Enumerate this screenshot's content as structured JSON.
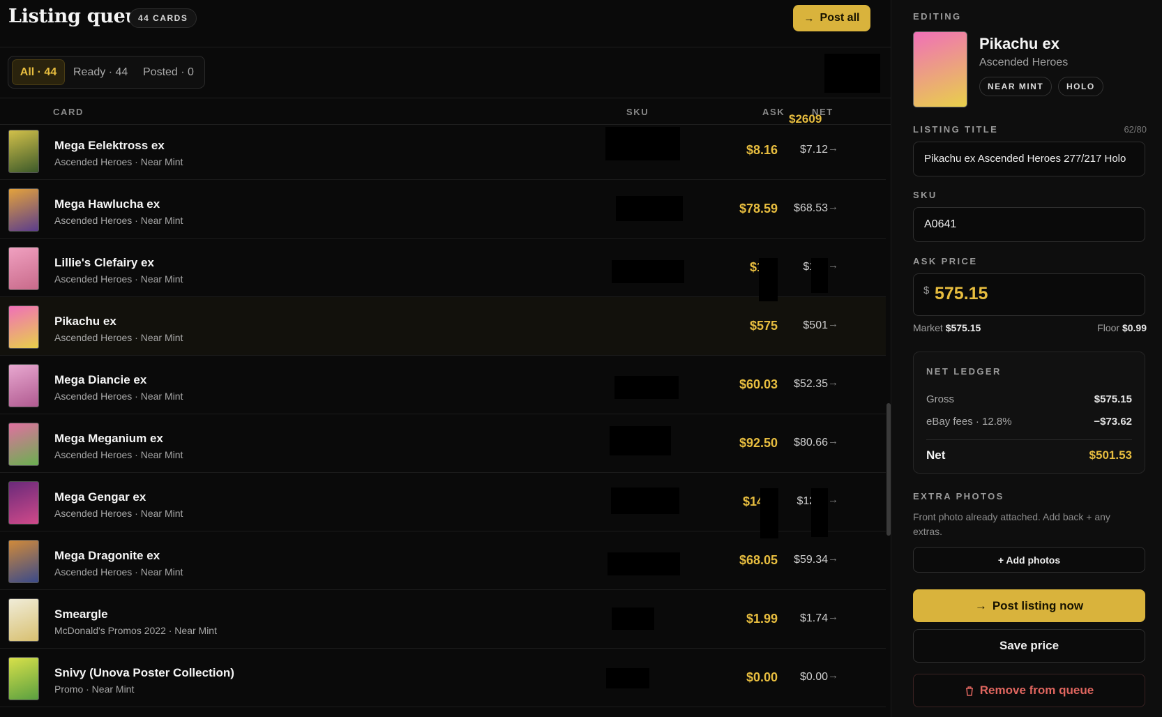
{
  "header": {
    "title": "Listing queue",
    "count_badge": "44 CARDS",
    "post_all_label": "Post all"
  },
  "filters": {
    "tabs": [
      {
        "label": "All · 44",
        "active": true
      },
      {
        "label": "Ready · 44",
        "active": false
      },
      {
        "label": "Posted · 0",
        "active": false
      }
    ],
    "total": "$2609"
  },
  "table": {
    "columns": {
      "card": "CARD",
      "sku": "SKU",
      "ask": "ASK",
      "net": "NET"
    },
    "rows": [
      {
        "name": "Mega Eelektross ex",
        "subtitle": "Ascended Heroes · Near Mint",
        "ask": "$8.16",
        "net": "$7.12",
        "thumb_colors": [
          "#d2c04a",
          "#3c5a2a"
        ]
      },
      {
        "name": "Mega Hawlucha ex",
        "subtitle": "Ascended Heroes · Near Mint",
        "ask": "$78.59",
        "net": "$68.53",
        "thumb_colors": [
          "#e3a23c",
          "#5b3d8c"
        ]
      },
      {
        "name": "Lillie's Clefairy ex",
        "subtitle": "Ascended Heroes · Near Mint",
        "ask": "$191",
        "net": "$166",
        "thumb_colors": [
          "#f0a0c0",
          "#c86a8a"
        ]
      },
      {
        "name": "Pikachu ex",
        "subtitle": "Ascended Heroes · Near Mint",
        "ask": "$575",
        "net": "$501",
        "thumb_colors": [
          "#f070b8",
          "#e8d04a"
        ],
        "selected": true
      },
      {
        "name": "Mega Diancie ex",
        "subtitle": "Ascended Heroes · Near Mint",
        "ask": "$60.03",
        "net": "$52.35",
        "thumb_colors": [
          "#e8a8d0",
          "#b05a90"
        ]
      },
      {
        "name": "Mega Meganium ex",
        "subtitle": "Ascended Heroes · Near Mint",
        "ask": "$92.50",
        "net": "$80.66",
        "thumb_colors": [
          "#e070a0",
          "#6ab050"
        ]
      },
      {
        "name": "Mega Gengar ex",
        "subtitle": "Ascended Heroes · Near Mint",
        "ask": "$1440",
        "net": "$1255",
        "thumb_colors": [
          "#6a2a7a",
          "#d04a8a"
        ]
      },
      {
        "name": "Mega Dragonite ex",
        "subtitle": "Ascended Heroes · Near Mint",
        "ask": "$68.05",
        "net": "$59.34",
        "thumb_colors": [
          "#d08a3a",
          "#3a4a8a"
        ]
      },
      {
        "name": "Smeargle",
        "subtitle": "McDonald's Promos 2022 · Near Mint",
        "ask": "$1.99",
        "net": "$1.74",
        "thumb_colors": [
          "#f0ecd8",
          "#d8c070"
        ]
      },
      {
        "name": "Snivy (Unova Poster Collection)",
        "subtitle": "Promo · Near Mint",
        "ask": "$0.00",
        "net": "$0.00",
        "thumb_colors": [
          "#d8e04a",
          "#5aa040"
        ]
      }
    ]
  },
  "detail": {
    "section_label": "EDITING",
    "name": "Pikachu ex",
    "set": "Ascended Heroes",
    "chips": [
      "NEAR MINT",
      "HOLO"
    ],
    "title_label": "LISTING TITLE",
    "title_count": "62/80",
    "title_value": "Pikachu ex Ascended Heroes 277/217 Holo",
    "sku_label": "SKU",
    "sku_value": "A0641",
    "price_label": "ASK PRICE",
    "currency": "$",
    "price_value": "575.15",
    "market_label": "Market",
    "market_value": "$575.15",
    "floor_label": "Floor",
    "floor_value": "$0.99",
    "ledger": {
      "label": "NET LEDGER",
      "gross_label": "Gross",
      "gross_value": "$575.15",
      "fees_label": "eBay fees · 12.8%",
      "fees_value": "−$73.62",
      "net_label": "Net",
      "net_value": "$501.53"
    },
    "photos_label": "EXTRA PHOTOS",
    "photos_hint": "Front photo already attached. Add back + any extras.",
    "add_photos_label": "+ Add photos",
    "post_now_label": "Post listing now",
    "save_price_label": "Save price",
    "remove_label": "Remove from queue"
  },
  "colors": {
    "accent": "#d9b33c",
    "accent_text": "#e7bd3f",
    "danger": "#e0665f",
    "background": "#0a0a0a"
  }
}
